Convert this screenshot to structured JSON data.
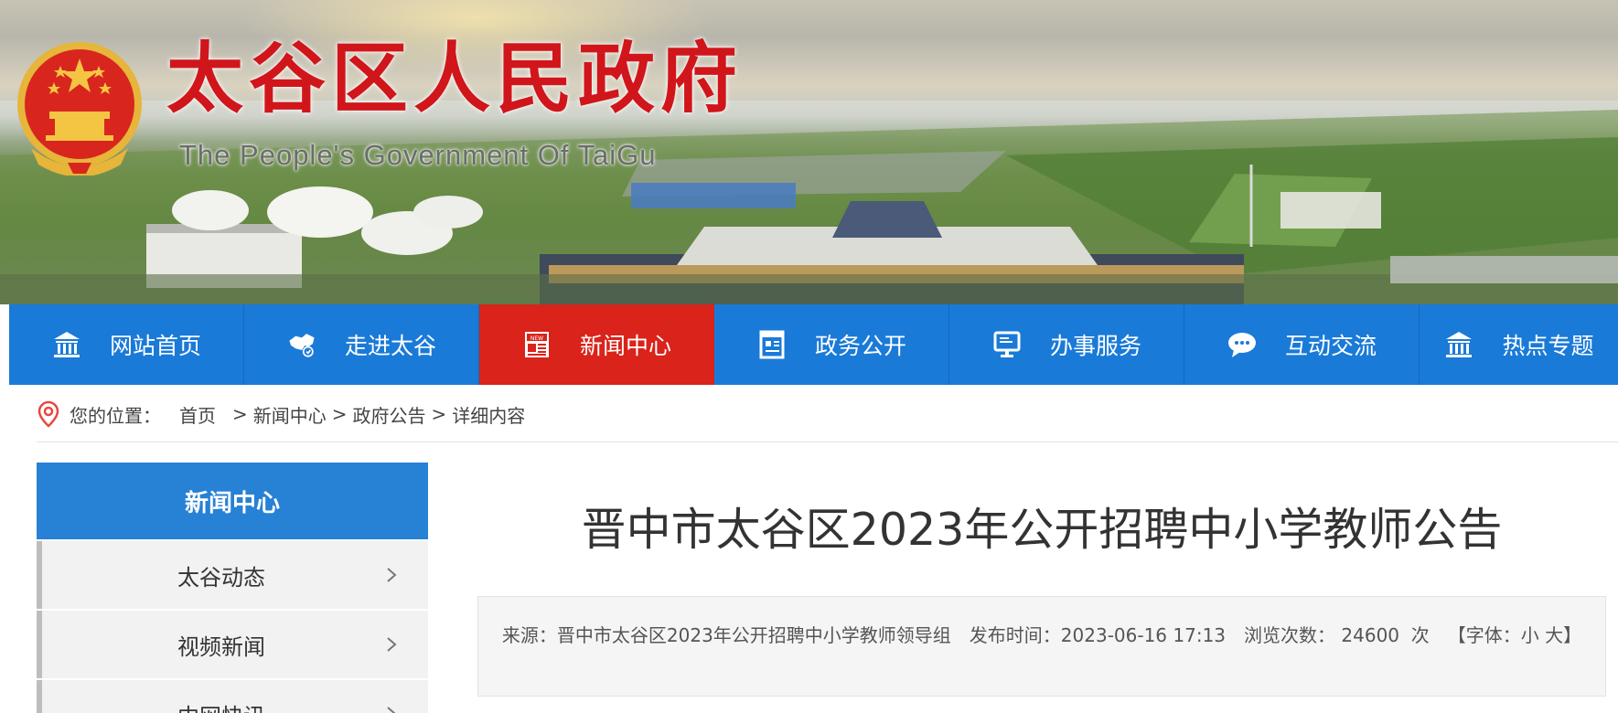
{
  "header": {
    "title": "太谷区人民政府",
    "subtitle": "The People's Government Of TaiGu",
    "colors": {
      "title_red": "#d0161b",
      "nav_blue": "#1a7ad8",
      "nav_active_red": "#d9231b",
      "sidebar_head_blue": "#2781d4"
    }
  },
  "nav": {
    "items": [
      {
        "label": "网站首页",
        "icon": "institution-icon"
      },
      {
        "label": "走进太谷",
        "icon": "map-region-icon"
      },
      {
        "label": "新闻中心",
        "icon": "news-icon",
        "active": true
      },
      {
        "label": "政务公开",
        "icon": "document-icon"
      },
      {
        "label": "办事服务",
        "icon": "monitor-icon"
      },
      {
        "label": "互动交流",
        "icon": "chat-icon"
      },
      {
        "label": "热点专题",
        "icon": "institution-icon"
      }
    ]
  },
  "breadcrumb": {
    "prefix": "您的位置：",
    "items": [
      "首页",
      "新闻中心",
      "政府公告",
      "详细内容"
    ],
    "separator": ">"
  },
  "sidebar": {
    "title": "新闻中心",
    "items": [
      {
        "label": "太谷动态"
      },
      {
        "label": "视频新闻"
      },
      {
        "label": "中网快讯"
      }
    ]
  },
  "article": {
    "title": "晋中市太谷区2023年公开招聘中小学教师公告",
    "meta": {
      "source_label": "来源：",
      "source": "晋中市太谷区2023年公开招聘中小学教师领导组",
      "publish_label": "发布时间：",
      "publish_time": "2023-06-16 17:13",
      "views_label": "浏览次数：",
      "views": "24600",
      "views_unit": "次",
      "font_prefix": "【字体：",
      "font_small": "小",
      "font_large": "大",
      "font_suffix": "】"
    }
  }
}
